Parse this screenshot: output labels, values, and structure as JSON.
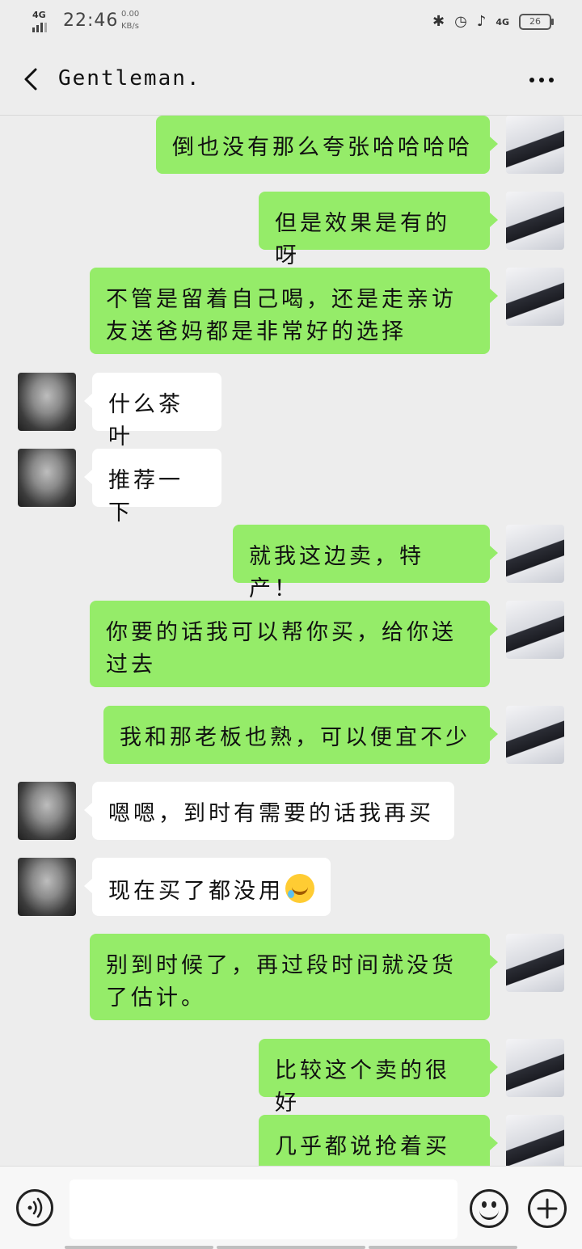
{
  "status_bar": {
    "network": "4G",
    "time": "22:46",
    "speed_value": "0.00",
    "speed_unit": "KB/s",
    "network_right": "4G",
    "battery": "26"
  },
  "header": {
    "title": "Gentleman."
  },
  "messages": [
    {
      "side": "me",
      "text": "倒也没有那么夸张哈哈哈哈"
    },
    {
      "side": "me",
      "text": "但是效果是有的呀"
    },
    {
      "side": "me",
      "text": "不管是留着自己喝，还是走亲访友送爸妈都是非常好的选择"
    },
    {
      "side": "other",
      "text": "什么茶叶"
    },
    {
      "side": "other",
      "text": "推荐一下"
    },
    {
      "side": "me",
      "text": "就我这边卖，特产！"
    },
    {
      "side": "me",
      "text": "你要的话我可以帮你买，给你送过去"
    },
    {
      "side": "me",
      "text": "我和那老板也熟，可以便宜不少"
    },
    {
      "side": "other",
      "text": "嗯嗯，到时有需要的话我再买"
    },
    {
      "side": "other",
      "text": "现在买了都没用"
    },
    {
      "side": "me",
      "text": "别到时候了，再过段时间就没货了估计。"
    },
    {
      "side": "me",
      "text": "比较这个卖的很好"
    },
    {
      "side": "me",
      "text": "几乎都说抢着买的"
    }
  ],
  "icons": {
    "back": "back-arrow-icon",
    "more": "more-icon",
    "voice": "voice-icon",
    "emoji": "emoji-icon",
    "plus": "plus-icon",
    "crying_laughing": "crying-laughing-emoji"
  }
}
